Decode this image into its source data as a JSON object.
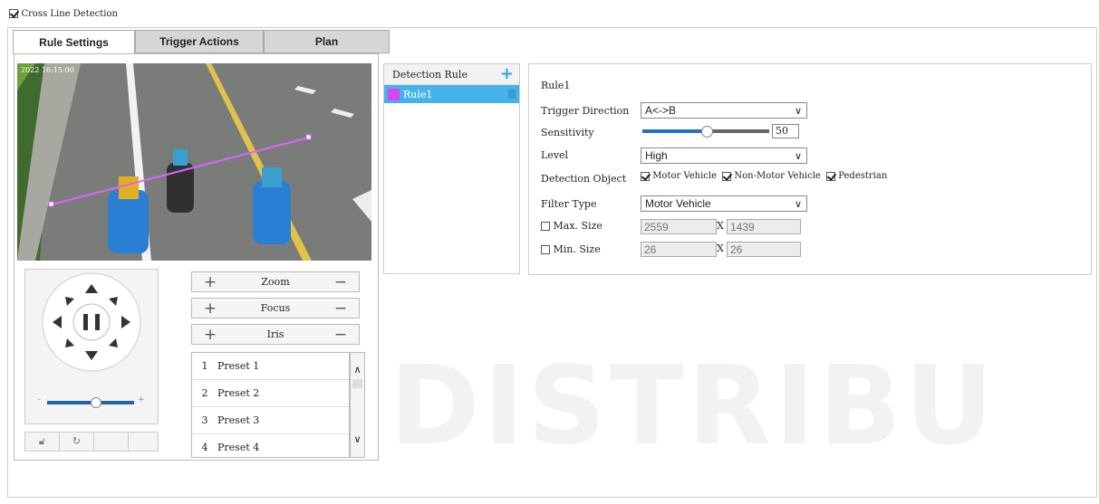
{
  "header": {
    "enable_label": "Cross Line Detection",
    "enabled": true
  },
  "tabs": [
    {
      "label": "Rule Settings",
      "active": true
    },
    {
      "label": "Trigger Actions",
      "active": false
    },
    {
      "label": "Plan",
      "active": false
    }
  ],
  "video": {
    "timestamp": "2022 16:15:00"
  },
  "ptz": {
    "zoom_label": "Zoom",
    "focus_label": "Focus",
    "iris_label": "Iris",
    "speed_level": 0.55,
    "speed_min_label": "-",
    "speed_max_label": "+"
  },
  "presets": [
    {
      "num": "1",
      "name": "Preset 1"
    },
    {
      "num": "2",
      "name": "Preset 2"
    },
    {
      "num": "3",
      "name": "Preset 3"
    },
    {
      "num": "4",
      "name": "Preset 4"
    }
  ],
  "detection_rules": {
    "title": "Detection Rule",
    "add_icon": "plus-icon",
    "items": [
      {
        "name": "Rule1",
        "color": "#d946ef",
        "selected": true
      }
    ]
  },
  "rule_config": {
    "rule_name": "Rule1",
    "trigger_direction_label": "Trigger Direction",
    "trigger_direction_value": "A<->B",
    "sensitivity_label": "Sensitivity",
    "sensitivity_value": "50",
    "sensitivity_fraction": 0.5,
    "level_label": "Level",
    "level_value": "High",
    "detection_object_label": "Detection Object",
    "object_motor": "Motor Vehicle",
    "object_nonmotor": "Non-Motor Vehicle",
    "object_pedestrian": "Pedestrian",
    "filter_type_label": "Filter Type",
    "filter_type_value": "Motor Vehicle",
    "max_size_label": "Max. Size",
    "max_w": "2559",
    "max_h": "1439",
    "min_size_label": "Min. Size",
    "min_w": "26",
    "min_h": "26",
    "x_sep": "X"
  },
  "colors": {
    "accent": "#45b3ea",
    "rule_line": "#d966ff"
  },
  "watermark": "DISTRIBU"
}
